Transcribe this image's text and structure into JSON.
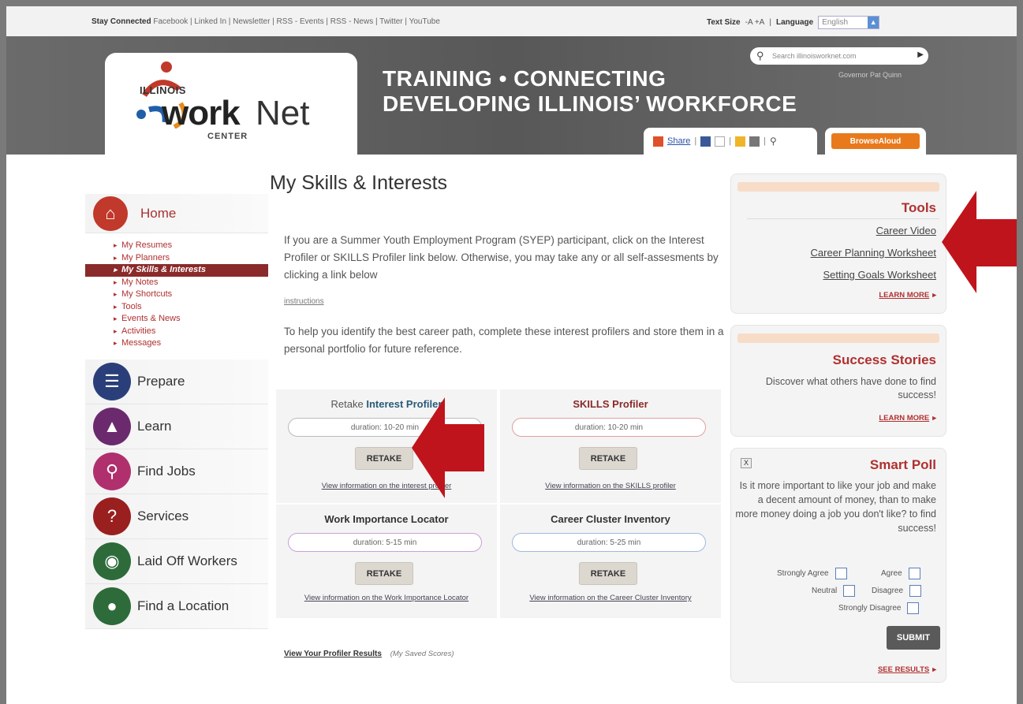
{
  "topbar": {
    "stay_connected": "Stay Connected",
    "links": "Facebook | Linked In | Newsletter | RSS - Events | RSS - News | Twitter | YouTube",
    "text_size_label": "Text Size",
    "text_size_options": "-A +A",
    "separator": "|",
    "language_label": "Language",
    "language_value": "English"
  },
  "header": {
    "logo_illinois": "ILLINOIS",
    "logo_work": "work",
    "logo_net": "Net",
    "logo_center": "CENTER",
    "title_line1": "TRAINING • CONNECTING",
    "title_line2": "DEVELOPING ILLINOIS’ WORKFORCE",
    "search_placeholder": "Search illinoisworknet.com",
    "governor": "Governor Pat Quinn",
    "share_label": "Share",
    "browse_label": "BrowseAloud"
  },
  "nav": {
    "home": "Home",
    "sub_items": [
      "My Resumes",
      "My Planners",
      "My Skills & Interests",
      "My Notes",
      "My Shortcuts",
      "Tools",
      "Events & News",
      "Activities",
      "Messages"
    ],
    "prepare": "Prepare",
    "learn": "Learn",
    "find_jobs": "Find Jobs",
    "services": "Services",
    "laid_off": "Laid Off Workers",
    "find_location": "Find a Location"
  },
  "main": {
    "title": "My Skills & Interests",
    "intro": "If you are a Summer Youth Employment Program (SYEP) participant, click on the Interest Profiler or SKILLS Profiler link below. Otherwise, you may take any or all self-assesments by clicking a link below",
    "instructions": "instructions",
    "intro2": "To help you identify the best career path, complete these interest profilers and store them in a personal portfolio for future reference.",
    "profilers": [
      {
        "prefix": "Retake ",
        "title": "Interest Profiler",
        "duration": "duration: 10-20 min",
        "button": "RETAKE",
        "info": "View information on the interest profiler"
      },
      {
        "prefix": "",
        "title": "SKILLS Profiler",
        "duration": "duration: 10-20 min",
        "button": "RETAKE",
        "info": "View information on the SKILLS profiler"
      },
      {
        "prefix": "",
        "title": "Work Importance Locator",
        "duration": "duration: 5-15 min",
        "button": "RETAKE",
        "info": "View information on the Work Importance Locator"
      },
      {
        "prefix": "",
        "title": "Career Cluster Inventory",
        "duration": "duration: 5-25 min",
        "button": "RETAKE",
        "info": "View information on the Career Cluster Inventory"
      }
    ],
    "results_link": "View Your Profiler Results",
    "results_note": "(My Saved Scores)"
  },
  "tools": {
    "title": "Tools",
    "items": [
      "Career Video",
      "Career Planning Worksheet",
      "Setting Goals Worksheet"
    ],
    "learn_more": "LEARN MORE"
  },
  "success": {
    "title": "Success Stories",
    "text": "Discover what others have done to find success!",
    "learn_more": "LEARN MORE"
  },
  "poll": {
    "close": "X",
    "title": "Smart Poll",
    "question": "Is it more important to like your job and make a decent amount of money, than to make more money doing a job you don't like? to find success!",
    "options": [
      "Strongly Agree",
      "Agree",
      "Neutral",
      "Disagree",
      "Strongly Disagree"
    ],
    "submit": "SUBMIT",
    "see_results": "SEE RESULTS"
  },
  "colors": {
    "brand_red": "#b03030",
    "arrow_red": "#c0141c",
    "banner_gray": "#5f5f5f",
    "browse_orange": "#e87a1c"
  }
}
